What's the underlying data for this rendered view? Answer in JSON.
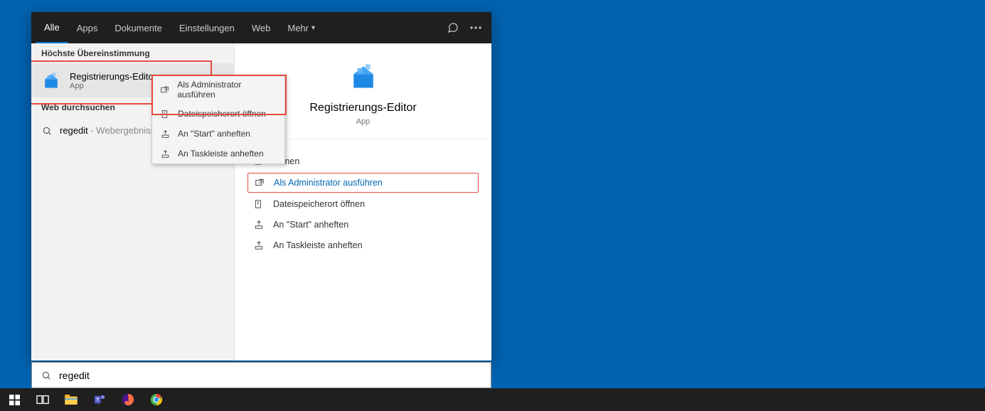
{
  "tabs": {
    "all": "Alle",
    "apps": "Apps",
    "documents": "Dokumente",
    "settings": "Einstellungen",
    "web": "Web",
    "more": "Mehr"
  },
  "sections": {
    "best_match": "Höchste Übereinstimmung",
    "web_search": "Web durchsuchen"
  },
  "result": {
    "title": "Registrierungs-Editor",
    "sub": "App"
  },
  "web": {
    "query": "regedit",
    "hint": " - Webergebnisse anze"
  },
  "context_menu": {
    "items": [
      "Als Administrator ausführen",
      "Dateispeicherort öffnen",
      "An \"Start\" anheften",
      "An Taskleiste anheften"
    ]
  },
  "detail": {
    "title": "Registrierungs-Editor",
    "sub": "App",
    "actions": [
      "Öffnen",
      "Als Administrator ausführen",
      "Dateispeicherort öffnen",
      "An \"Start\" anheften",
      "An Taskleiste anheften"
    ]
  },
  "search": {
    "value": "regedit"
  }
}
